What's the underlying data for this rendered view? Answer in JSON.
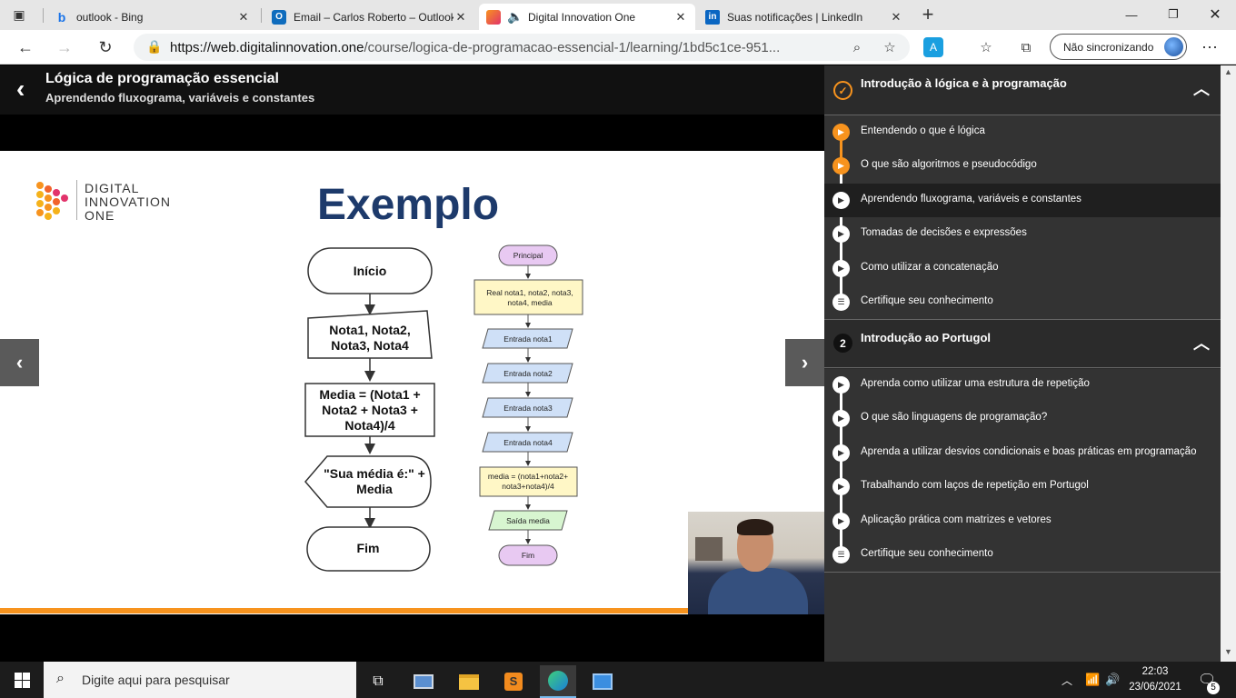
{
  "browser": {
    "tabs": [
      {
        "label": "outlook - Bing",
        "icon": "bing-icon"
      },
      {
        "label": "Email – Carlos Roberto – Outlook",
        "icon": "outlook-icon"
      },
      {
        "label": "Digital Innovation One",
        "icon": "dio-icon",
        "active": true
      },
      {
        "label": "Suas notificações | LinkedIn",
        "icon": "linkedin-icon"
      }
    ],
    "url_host": "https://web.digitalinnovation.one",
    "url_path": "/course/logica-de-programacao-essencial-1/learning/1bd5c1ce-951...",
    "sync_label": "Não sincronizando"
  },
  "course": {
    "title": "Lógica de programação essencial",
    "lesson": "Aprendendo fluxograma, variáveis e constantes"
  },
  "slide": {
    "logo": [
      "DIGITAL",
      "INNOVATION",
      "ONE"
    ],
    "title": "Exemplo",
    "left_flow": {
      "start": "Início",
      "input": [
        "Nota1, Nota2,",
        "Nota3, Nota4"
      ],
      "process": [
        "Media = (Nota1 +",
        "Nota2 + Nota3 +",
        "Nota4)/4"
      ],
      "display": [
        "\"Sua média é:\" +",
        "Media"
      ],
      "end": "Fim"
    },
    "right_flow": {
      "start": "Principal",
      "declare": [
        "Real nota1, nota2, nota3,",
        "nota4, media"
      ],
      "inputs": [
        "Entrada nota1",
        "Entrada nota2",
        "Entrada nota3",
        "Entrada nota4"
      ],
      "assign": [
        "media = (nota1+nota2+",
        "nota3+nota4)/4"
      ],
      "output": "Saída media",
      "end": "Fim"
    }
  },
  "sidebar": {
    "sections": [
      {
        "title": "Introdução à lógica e à programação",
        "lessons": [
          {
            "label": "Entendendo o que é lógica",
            "state": "done"
          },
          {
            "label": "O que são algoritmos e pseudocódigo",
            "state": "done"
          },
          {
            "label": "Aprendendo fluxograma, variáveis e constantes",
            "state": "current"
          },
          {
            "label": "Tomadas de decisões e expressões",
            "state": "todo"
          },
          {
            "label": "Como utilizar a concatenação",
            "state": "todo"
          },
          {
            "label": "Certifique seu conhecimento",
            "state": "quiz"
          }
        ]
      },
      {
        "number": "2",
        "title": "Introdução ao Portugol",
        "lessons": [
          {
            "label": "Aprenda como utilizar uma estrutura de repetição",
            "state": "todo"
          },
          {
            "label": "O que são linguagens de programação?",
            "state": "todo"
          },
          {
            "label": "Aprenda a utilizar desvios condicionais e boas práticas em programação",
            "state": "todo"
          },
          {
            "label": "Trabalhando com laços de repetição em Portugol",
            "state": "todo"
          },
          {
            "label": "Aplicação prática com matrizes e vetores",
            "state": "todo"
          },
          {
            "label": "Certifique seu conhecimento",
            "state": "quiz"
          }
        ]
      }
    ]
  },
  "taskbar": {
    "search_placeholder": "Digite aqui para pesquisar",
    "time": "22:03",
    "date": "23/06/2021",
    "notifications": "5"
  },
  "colors": {
    "accent": "#f7931e",
    "slide_title": "#1d3a6b",
    "sidebar_bg": "#333333"
  }
}
